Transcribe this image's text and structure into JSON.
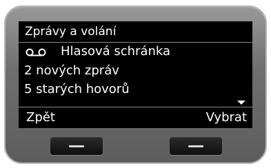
{
  "screen": {
    "title": "Zprávy a volání",
    "items": [
      {
        "icon": "voicemail-icon",
        "label": "Hlasová schránka"
      },
      {
        "label": "2 nových zpráv"
      },
      {
        "label": "5 starých hovorů"
      }
    ]
  },
  "softkeys": {
    "left_label": "Zpět",
    "right_label": "Vybrat"
  }
}
